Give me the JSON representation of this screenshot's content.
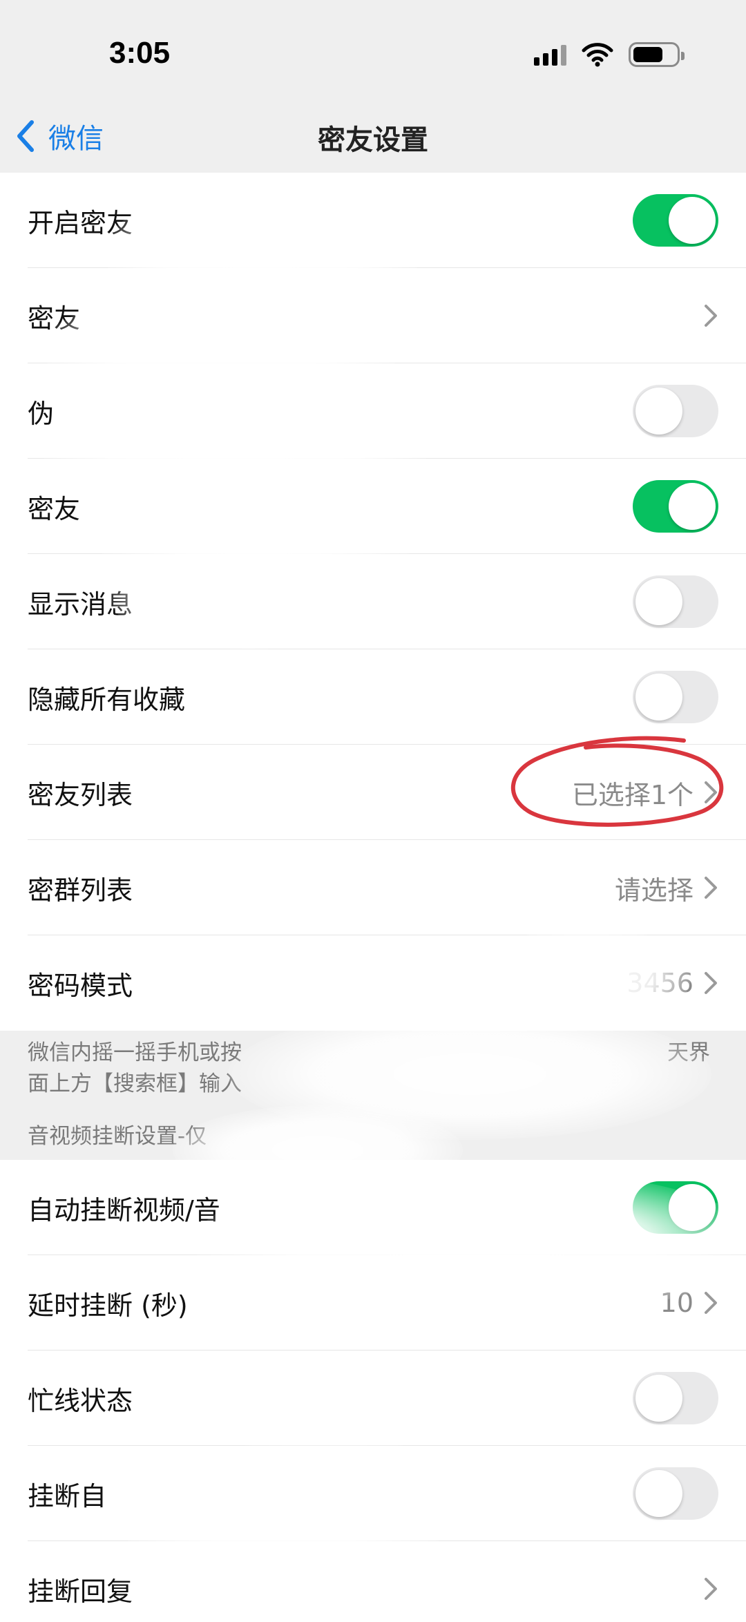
{
  "status_bar": {
    "time": "3:05",
    "signal_icon": "cellular-signal-icon",
    "wifi_icon": "wifi-icon",
    "battery_icon": "battery-icon",
    "battery_level": 0.7
  },
  "nav": {
    "back_label": "微信",
    "title": "密友设置"
  },
  "rows_group1": [
    {
      "label": "开启密友",
      "control": "toggle",
      "on": true
    },
    {
      "label": "密友",
      "control": "chevron"
    },
    {
      "label": "伪",
      "control": "toggle",
      "on": false
    },
    {
      "label": "密友",
      "control": "toggle",
      "on": true
    },
    {
      "label": "显示消息",
      "control": "toggle",
      "on": false
    },
    {
      "label": "隐藏所有收藏",
      "control": "toggle",
      "on": false
    },
    {
      "label": "密友列表",
      "control": "chevron",
      "value": "已选择1个"
    },
    {
      "label": "密群列表",
      "control": "chevron",
      "value": "请选择"
    },
    {
      "label": "密码模式",
      "control": "chevron",
      "value": "3456"
    }
  ],
  "note": {
    "line1": "微信内摇一摇手机或按",
    "line1_tail": "天界",
    "line2": "面上方【搜索框】输入"
  },
  "section2_header": "音视频挂断设置-仅",
  "rows_group2": [
    {
      "label": "自动挂断视频/音",
      "control": "toggle",
      "on": true
    },
    {
      "label": "延时挂断 (秒)",
      "control": "chevron",
      "value": "10"
    },
    {
      "label": "忙线状态",
      "control": "toggle",
      "on": false
    },
    {
      "label": "挂断自",
      "control": "toggle",
      "on": false
    },
    {
      "label": "挂断回复",
      "control": "chevron"
    }
  ],
  "colors": {
    "accent_blue": "#1a7fe6",
    "toggle_green": "#07c160",
    "annotation_red": "#d9363e",
    "group_background": "#efefef"
  }
}
